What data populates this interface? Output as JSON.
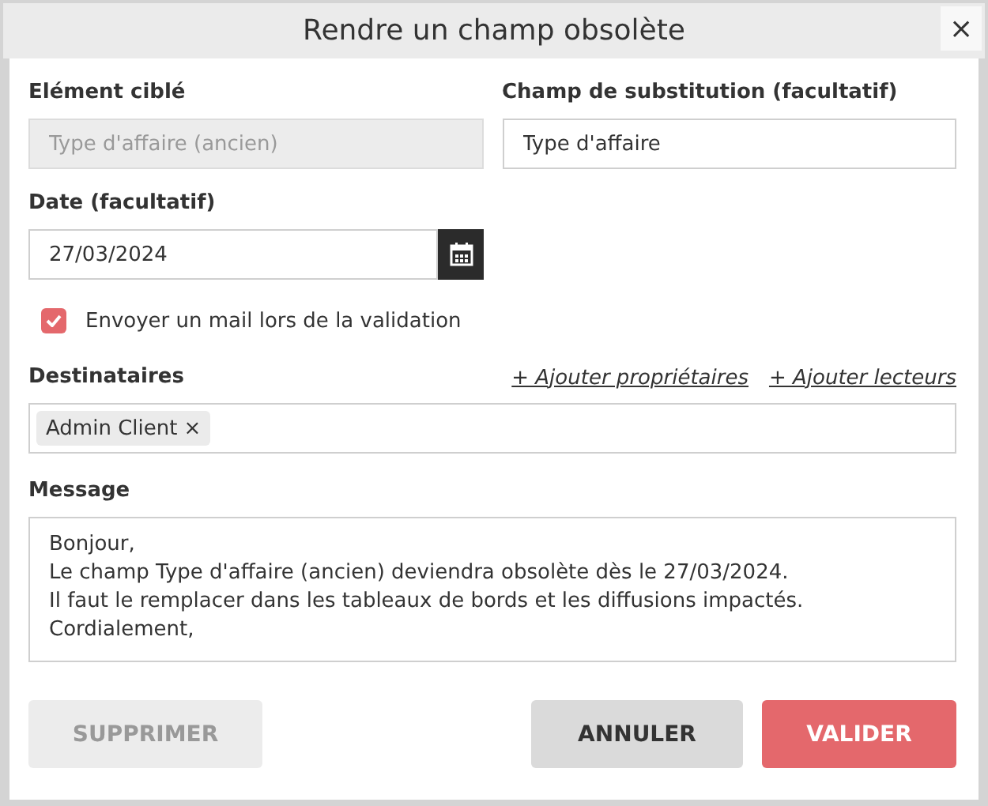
{
  "window": {
    "title": "Rendre un champ obsolète",
    "close": "×"
  },
  "target": {
    "label": "Elément ciblé",
    "value": "Type d'affaire (ancien)",
    "disabled": true
  },
  "substitute": {
    "label": "Champ de substitution (facultatif)",
    "value": "Type d'affaire",
    "disabled": false
  },
  "date": {
    "label": "Date (facultatif)",
    "value": "27/03/2024"
  },
  "send_mail": {
    "label": "Envoyer un mail lors de la validation",
    "checked": true
  },
  "recipients": {
    "label": "Destinataires",
    "links": [
      "+ Ajouter propriétaires",
      "+ Ajouter lecteurs"
    ],
    "chips": [
      {
        "label": "Admin Client",
        "remove": "×"
      }
    ]
  },
  "message": {
    "label": "Message",
    "lines": [
      "Bonjour,",
      "Le champ Type d'affaire (ancien) deviendra obsolète dès le 27/03/2024.",
      "Il faut le remplacer dans les tableaux de bords et les diffusions impactés.",
      "Cordialement,"
    ]
  },
  "buttons": [
    {
      "label": "SUPPRIMER",
      "kind": "secondary",
      "disabled": true
    },
    {
      "label": "ANNULER",
      "kind": "secondary",
      "disabled": false
    },
    {
      "label": "VALIDER",
      "kind": "primary",
      "disabled": false
    }
  ]
}
